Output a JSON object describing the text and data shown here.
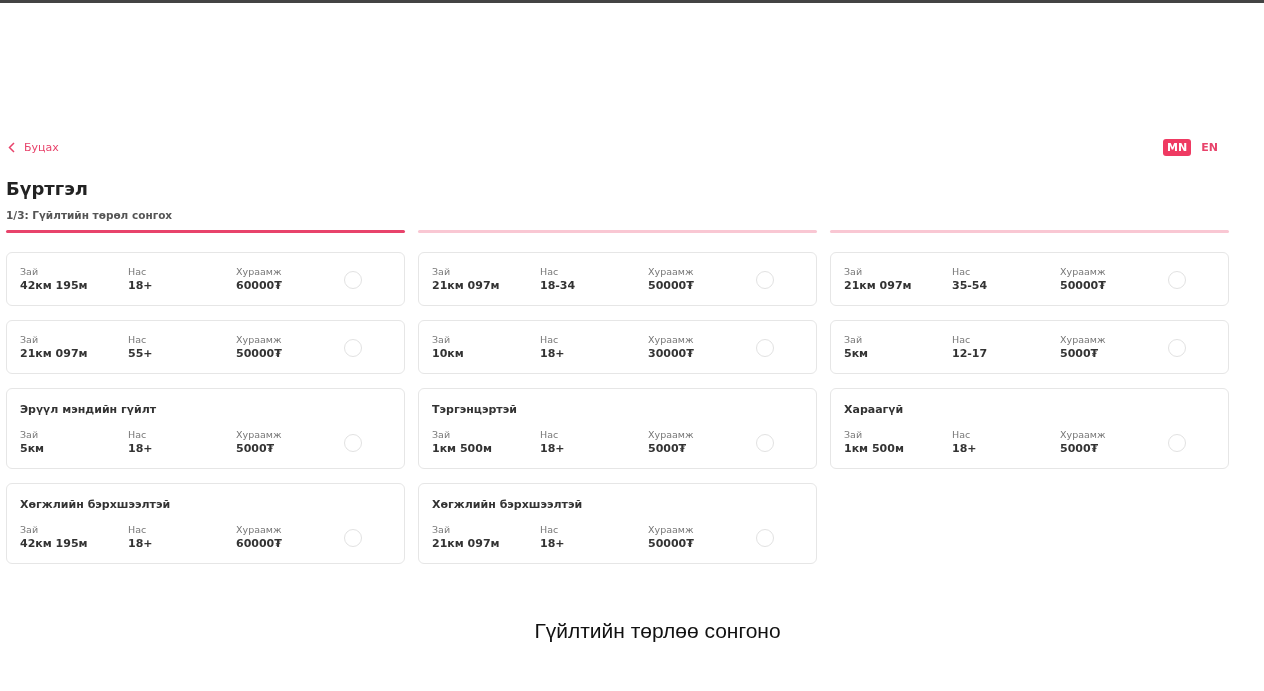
{
  "back_link": {
    "label": "Буцах"
  },
  "languages": [
    {
      "label": "MN",
      "selected": true
    },
    {
      "label": "EN",
      "selected": false
    }
  ],
  "title": "Бүртгэл",
  "steps": [
    {
      "label": "1/3: Гүйлтийн төрөл сонгох",
      "active": true
    },
    {
      "active": false
    },
    {
      "active": false
    }
  ],
  "cards": [
    {
      "fields": [
        {
          "label": "Зай",
          "value": "42км 195м"
        },
        {
          "label": "Нас",
          "value": "18+"
        },
        {
          "label": "Хураамж",
          "value": "60000₮"
        }
      ],
      "selected": false
    },
    {
      "fields": [
        {
          "label": "Зай",
          "value": "21км 097м"
        },
        {
          "label": "Нас",
          "value": "18-34"
        },
        {
          "label": "Хураамж",
          "value": "50000₮"
        }
      ],
      "selected": false
    },
    {
      "fields": [
        {
          "label": "Зай",
          "value": "21км 097м"
        },
        {
          "label": "Нас",
          "value": "35-54"
        },
        {
          "label": "Хураамж",
          "value": "50000₮"
        }
      ],
      "selected": false
    },
    {
      "fields": [
        {
          "label": "Зай",
          "value": "21км 097м"
        },
        {
          "label": "Нас",
          "value": "55+"
        },
        {
          "label": "Хураамж",
          "value": "50000₮"
        }
      ],
      "selected": false
    },
    {
      "fields": [
        {
          "label": "Зай",
          "value": "10км"
        },
        {
          "label": "Нас",
          "value": "18+"
        },
        {
          "label": "Хураамж",
          "value": "30000₮"
        }
      ],
      "selected": false
    },
    {
      "fields": [
        {
          "label": "Зай",
          "value": "5км"
        },
        {
          "label": "Нас",
          "value": "12-17"
        },
        {
          "label": "Хураамж",
          "value": "5000₮"
        }
      ],
      "selected": false
    },
    {
      "title": "Эрүүл мэндийн гүйлт",
      "fields": [
        {
          "label": "Зай",
          "value": "5км"
        },
        {
          "label": "Нас",
          "value": "18+"
        },
        {
          "label": "Хураамж",
          "value": "5000₮"
        }
      ],
      "selected": false
    },
    {
      "title": "Тэргэнцэртэй",
      "fields": [
        {
          "label": "Зай",
          "value": "1км 500м"
        },
        {
          "label": "Нас",
          "value": "18+"
        },
        {
          "label": "Хураамж",
          "value": "5000₮"
        }
      ],
      "selected": false
    },
    {
      "title": "Хараагүй",
      "fields": [
        {
          "label": "Зай",
          "value": "1км 500м"
        },
        {
          "label": "Нас",
          "value": "18+"
        },
        {
          "label": "Хураамж",
          "value": "5000₮"
        }
      ],
      "selected": false
    },
    {
      "title": "Хөгжлийн бэрхшээлтэй",
      "fields": [
        {
          "label": "Зай",
          "value": "42км 195м"
        },
        {
          "label": "Нас",
          "value": "18+"
        },
        {
          "label": "Хураамж",
          "value": "60000₮"
        }
      ],
      "selected": false
    },
    {
      "title": "Хөгжлийн бэрхшээлтэй",
      "fields": [
        {
          "label": "Зай",
          "value": "21км 097м"
        },
        {
          "label": "Нас",
          "value": "18+"
        },
        {
          "label": "Хураамж",
          "value": "50000₮"
        }
      ],
      "selected": false
    }
  ],
  "caption": "Гүйлтийн төрлөө сонгоно"
}
